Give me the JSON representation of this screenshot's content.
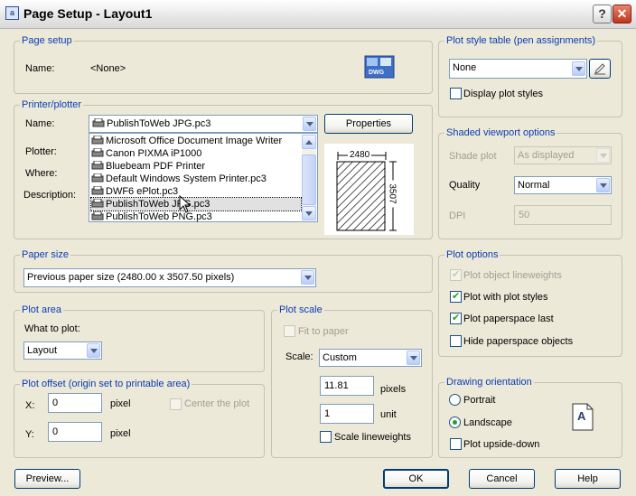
{
  "window": {
    "title": "Page Setup - Layout1",
    "app_icon_text": "a"
  },
  "page_setup": {
    "title": "Page setup",
    "name_label": "Name:",
    "name_value": "<None>"
  },
  "printer": {
    "title": "Printer/plotter",
    "name_label": "Name:",
    "name_value": "PublishToWeb JPG.pc3",
    "properties_label": "Properties",
    "plotter_label": "Plotter:",
    "where_label": "Where:",
    "description_label": "Description:",
    "dropdown_items": [
      "Microsoft Office Document Image Writer",
      "Canon PIXMA iP1000",
      "Bluebeam PDF Printer",
      "Default Windows System Printer.pc3",
      "DWF6 ePlot.pc3",
      "PublishToWeb JPG.pc3",
      "PublishToWeb PNG.pc3"
    ],
    "selected_index": 5,
    "preview_width": "2480",
    "preview_height": "3507"
  },
  "paper_size": {
    "title": "Paper size",
    "value": "Previous paper size  (2480.00 x 3507.50 pixels)"
  },
  "plot_area": {
    "title": "Plot area",
    "what_label": "What to plot:",
    "value": "Layout"
  },
  "plot_offset": {
    "title": "Plot offset (origin set to printable area)",
    "x_label": "X:",
    "x_value": "0",
    "y_label": "Y:",
    "y_value": "0",
    "unit": "pixel",
    "center_label": "Center the plot"
  },
  "plot_scale": {
    "title": "Plot scale",
    "fit_label": "Fit to paper",
    "scale_label": "Scale:",
    "scale_value": "Custom",
    "value1": "11.81",
    "unit1": "pixels",
    "value2": "1",
    "unit2": "unit",
    "lineweights_label": "Scale lineweights"
  },
  "plot_style_table": {
    "title": "Plot style table (pen assignments)",
    "value": "None",
    "display_label": "Display plot styles"
  },
  "shaded": {
    "title": "Shaded viewport options",
    "shade_label": "Shade plot",
    "shade_value": "As displayed",
    "quality_label": "Quality",
    "quality_value": "Normal",
    "dpi_label": "DPI",
    "dpi_value": "50"
  },
  "plot_options": {
    "title": "Plot options",
    "items": [
      {
        "label": "Plot object lineweights",
        "checked": true,
        "disabled": true
      },
      {
        "label": "Plot with plot styles",
        "checked": true,
        "disabled": false
      },
      {
        "label": "Plot paperspace last",
        "checked": true,
        "disabled": false
      },
      {
        "label": "Hide paperspace objects",
        "checked": false,
        "disabled": false
      }
    ]
  },
  "orientation": {
    "title": "Drawing orientation",
    "portrait": "Portrait",
    "landscape": "Landscape",
    "upside_down": "Plot upside-down",
    "glyph": "A"
  },
  "footer": {
    "preview": "Preview...",
    "ok": "OK",
    "cancel": "Cancel",
    "help": "Help"
  },
  "colors": {
    "group_title": "#0a3bb4",
    "dialog_bg": "#ece9d8",
    "close_red": "#c2351a",
    "check_green": "#21a121"
  }
}
